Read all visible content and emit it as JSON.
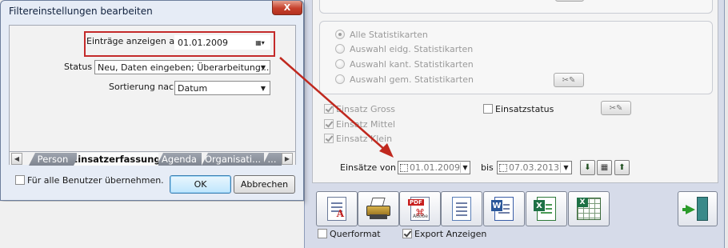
{
  "dialog": {
    "title": "Filtereinstellungen bearbeiten",
    "close_glyph": "X",
    "entries_label": "Einträge anzeigen ab",
    "entries_date": "01.01.2009",
    "status_label": "Status",
    "status_value": "Neu, Daten eingeben; Überarbeitung...",
    "sort_label": "Sortierung nach",
    "sort_value": "Datum",
    "tabs": [
      "Person",
      "Einsatzerfassung",
      "Agenda",
      "Organisati...",
      "..."
    ],
    "active_tab": "Einsatzerfassung",
    "apply_all_label": "Für alle Benutzer übernehmen.",
    "ok_label": "OK",
    "cancel_label": "Abbrechen"
  },
  "background": {
    "radio_options": [
      "Alle Statistikarten",
      "Auswahl eidg. Statistikarten",
      "Auswahl kant. Statistikarten",
      "Auswahl gem. Statistikarten"
    ],
    "selected_radio": "Alle Statistikarten",
    "einsatz_checks": [
      "Einsatz Gross",
      "Einsatz Mittel",
      "Einsatz Klein"
    ],
    "einsatzstatus_label": "Einsatzstatus",
    "einsaetze_von_label": "Einsätze von",
    "date_from": "01.01.2009",
    "bis_label": "bis",
    "date_to": "07.03.2013",
    "toolbar_icons": [
      "report-icon",
      "printer-icon",
      "pdf-icon",
      "document-icon",
      "word-icon",
      "excel-icon",
      "excel-table-icon"
    ],
    "pdf_badge": "PDF",
    "adobe_badge": "Adobe",
    "querformat_label": "Querformat",
    "export_label": "Export Anzeigen"
  },
  "colors": {
    "highlight_red": "#c42a2a",
    "arrow_red": "#c0281e",
    "window_frame": "#d6dbe9"
  }
}
